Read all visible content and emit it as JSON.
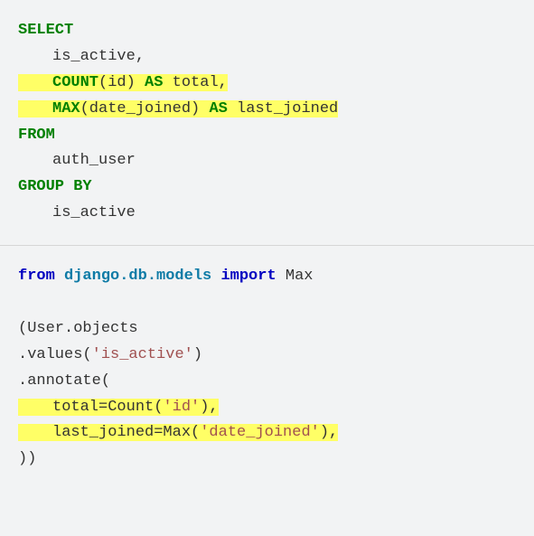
{
  "sql": {
    "select": "SELECT",
    "is_active": "is_active,",
    "count": "COUNT",
    "count_args": "(id) ",
    "as1": "AS",
    "total": " total,",
    "max": "MAX",
    "max_args": "(date_joined) ",
    "as2": "AS",
    "last_joined": " last_joined",
    "from": "FROM",
    "auth_user": "auth_user",
    "group_by": "GROUP BY",
    "is_active2": "is_active"
  },
  "py": {
    "from": "from",
    "module": "django.db.models",
    "import": "import",
    "max": "Max",
    "userobj": "(User.objects",
    "values": ".values(",
    "str1": "'is_active'",
    "close1": ")",
    "annotate": ".annotate(",
    "tc": "total=Count(",
    "str2": "'id'",
    "tc2": "),",
    "lj": "last_joined=Max(",
    "str3": "'date_joined'",
    "lj2": "),",
    "end": "))"
  }
}
